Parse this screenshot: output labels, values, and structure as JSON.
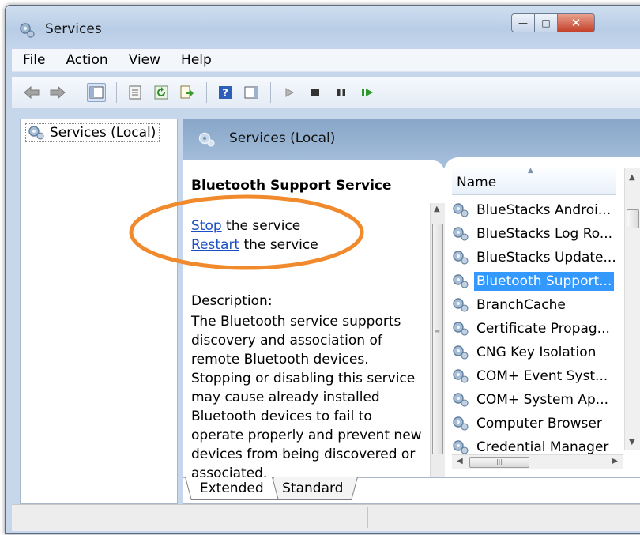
{
  "window": {
    "title": "Services"
  },
  "menu": [
    "File",
    "Action",
    "View",
    "Help"
  ],
  "tree": {
    "root_label": "Services (Local)"
  },
  "panel": {
    "header_title": "Services (Local)",
    "service_name": "Bluetooth Support Service",
    "stop_link": "Stop",
    "stop_suffix": " the service",
    "restart_link": "Restart",
    "restart_suffix": " the service",
    "description_label": "Description:",
    "description_text": "The Bluetooth service supports discovery and association of remote Bluetooth devices. Stopping or disabling this service may cause already installed Bluetooth devices to fail to operate properly and prevent new devices from being discovered or associated."
  },
  "list": {
    "column_name": "Name",
    "selected_index": 3,
    "items": [
      "BlueStacks Androi...",
      "BlueStacks Log Ro...",
      "BlueStacks Update...",
      "Bluetooth Support...",
      "BranchCache",
      "Certificate Propag...",
      "CNG Key Isolation",
      "COM+ Event Syst...",
      "COM+ System Ap...",
      "Computer Browser",
      "Credential Manager"
    ]
  },
  "tabs": {
    "extended": "Extended",
    "standard": "Standard"
  },
  "colors": {
    "selection": "#3399ff",
    "annotation_circle": "#f08a2c",
    "link": "#1d4fc4"
  }
}
